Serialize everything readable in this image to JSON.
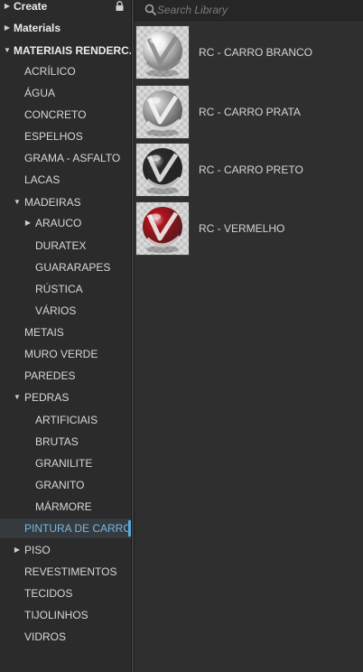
{
  "tree": {
    "items": [
      {
        "label": "Create",
        "arrow": "right",
        "locked": true
      },
      {
        "label": "Materials",
        "arrow": "right"
      },
      {
        "label": "MATERIAIS RENDERC...",
        "arrow": "down"
      },
      {
        "label": "ACRÍLICO"
      },
      {
        "label": "ÁGUA"
      },
      {
        "label": "CONCRETO"
      },
      {
        "label": "ESPELHOS"
      },
      {
        "label": "GRAMA - ASFALTO"
      },
      {
        "label": "LACAS"
      },
      {
        "label": "MADEIRAS",
        "arrow": "down"
      },
      {
        "label": "ARAUCO",
        "arrow": "right"
      },
      {
        "label": "DURATEX"
      },
      {
        "label": "GUARARAPES"
      },
      {
        "label": "RÚSTICA"
      },
      {
        "label": "VÁRIOS"
      },
      {
        "label": "METAIS"
      },
      {
        "label": "MURO VERDE"
      },
      {
        "label": "PAREDES"
      },
      {
        "label": "PEDRAS",
        "arrow": "down"
      },
      {
        "label": "ARTIFICIAIS"
      },
      {
        "label": "BRUTAS"
      },
      {
        "label": "GRANILITE"
      },
      {
        "label": "GRANITO"
      },
      {
        "label": "MÁRMORE"
      },
      {
        "label": "PINTURA DE CARRO",
        "selected": true
      },
      {
        "label": "PISO",
        "arrow": "right"
      },
      {
        "label": "REVESTIMENTOS"
      },
      {
        "label": "TECIDOS"
      },
      {
        "label": "TIJOLINHOS"
      },
      {
        "label": "VIDROS"
      }
    ]
  },
  "search": {
    "placeholder": "Search Library",
    "value": ""
  },
  "materials": [
    {
      "name": "RC - CARRO BRANCO",
      "icon": "white-car-paint-sphere-icon",
      "color": "#f2f2f2",
      "stripe": "#8a8a8a"
    },
    {
      "name": "RC - CARRO PRATA",
      "icon": "silver-car-paint-sphere-icon",
      "color": "#bdbdbd",
      "stripe": "#f5f5f5"
    },
    {
      "name": "RC - CARRO PRETO",
      "icon": "black-car-paint-sphere-icon",
      "color": "#2a2a2a",
      "stripe": "#e8e8e8"
    },
    {
      "name": "RC - VERMELHO",
      "icon": "red-car-paint-sphere-icon",
      "color": "#b0141e",
      "stripe": "#f0f0f0"
    }
  ]
}
